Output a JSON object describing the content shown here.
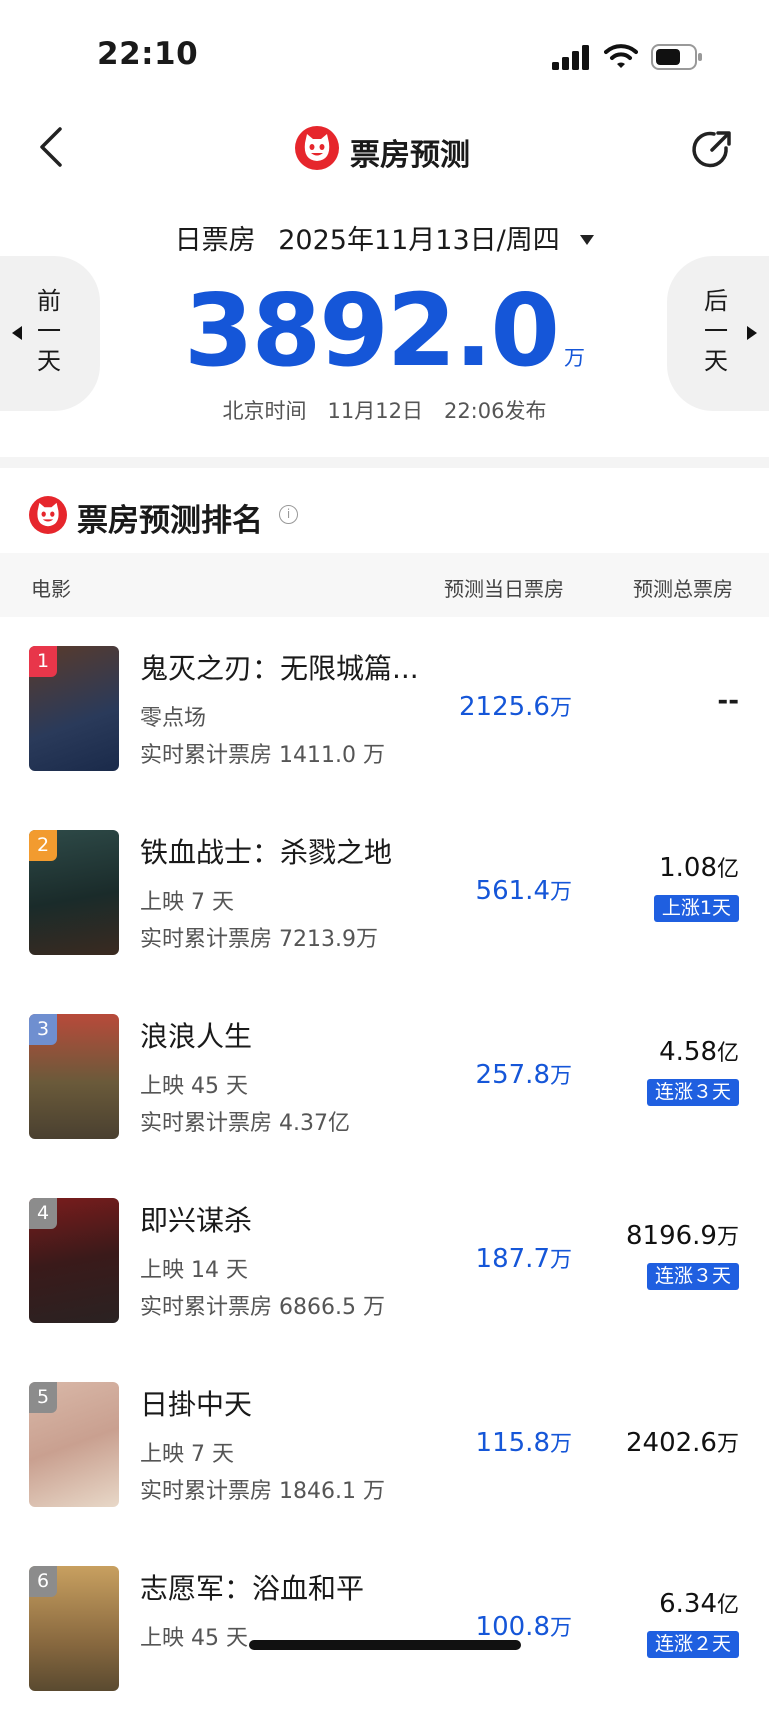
{
  "status_bar": {
    "time": "22:10"
  },
  "nav": {
    "title": "票房预测",
    "logo_icon": "maoyan-cat-logo-icon",
    "back_icon": "chevron-left-icon",
    "share_icon": "share-icon"
  },
  "date_bar": {
    "label": "日票房",
    "date": "2025年11月13日/周四"
  },
  "prev_day": {
    "label": "前一天"
  },
  "next_day": {
    "label": "后一天"
  },
  "forecast": {
    "value": "3892.0",
    "unit": "万",
    "publish_note": "北京时间　11月12日　22:06发布"
  },
  "ranking": {
    "title": "票房预测排名",
    "columns": {
      "movie": "电影",
      "daily": "预测当日票房",
      "total": "预测总票房"
    },
    "rows": [
      {
        "rank": "1",
        "title": "鬼灭之刃：无限城篇...",
        "sub": "零点场",
        "cumulative": "实时累计票房 1411.0 万",
        "daily": "2125.6",
        "daily_unit": "万",
        "total": "--",
        "total_unit": "",
        "badge": ""
      },
      {
        "rank": "2",
        "title": "铁血战士：杀戮之地",
        "sub": "上映 7 天",
        "cumulative": "实时累计票房 7213.9万",
        "daily": "561.4",
        "daily_unit": "万",
        "total": "1.08",
        "total_unit": "亿",
        "badge": "上涨1天"
      },
      {
        "rank": "3",
        "title": "浪浪人生",
        "sub": "上映 45 天",
        "cumulative": "实时累计票房 4.37亿",
        "daily": "257.8",
        "daily_unit": "万",
        "total": "4.58",
        "total_unit": "亿",
        "badge": "连涨３天"
      },
      {
        "rank": "4",
        "title": "即兴谋杀",
        "sub": "上映 14 天",
        "cumulative": "实时累计票房 6866.5 万",
        "daily": "187.7",
        "daily_unit": "万",
        "total": "8196.9",
        "total_unit": "万",
        "badge": "连涨３天"
      },
      {
        "rank": "5",
        "title": "日掛中天",
        "sub": "上映 7 天",
        "cumulative": "实时累计票房 1846.1 万",
        "daily": "115.8",
        "daily_unit": "万",
        "total": "2402.6",
        "total_unit": "万",
        "badge": ""
      },
      {
        "rank": "6",
        "title": "志愿军：浴血和平",
        "sub": "上映 45 天",
        "cumulative": "",
        "daily": "100.8",
        "daily_unit": "万",
        "total": "6.34",
        "total_unit": "亿",
        "badge": "连涨２天"
      }
    ]
  },
  "colors": {
    "accent_blue": "#1556d8",
    "brand_red": "#e6262c",
    "rank_1": "#e8364a",
    "rank_2": "#f29b2f",
    "rank_3": "#6f8fd0",
    "rank_other": "#8c8c8c",
    "badge_blue": "#1f5fe0"
  }
}
